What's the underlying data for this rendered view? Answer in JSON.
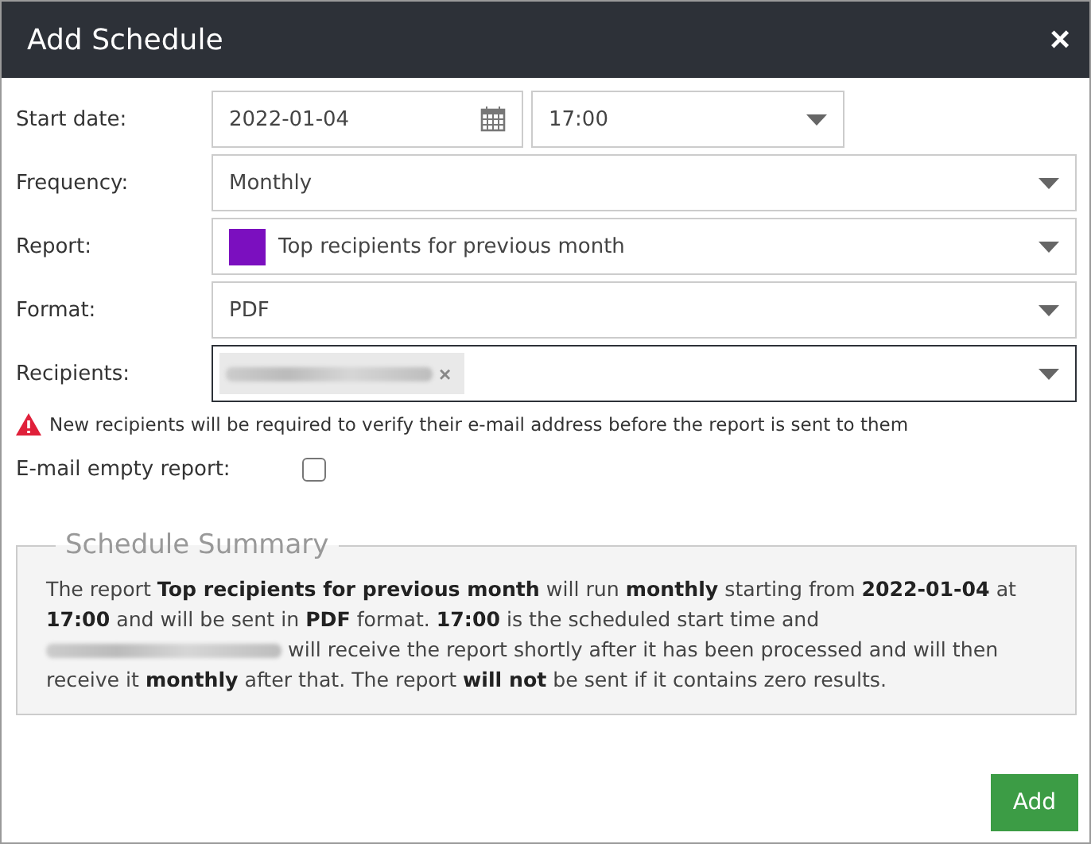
{
  "window": {
    "title": "Add Schedule",
    "close": "×"
  },
  "fields": [
    {
      "kind": "datetime",
      "label": "Start date:",
      "value": "2022-01-04",
      "time": "17:00"
    },
    {
      "kind": "select",
      "label": "Frequency:",
      "value": "Monthly"
    },
    {
      "kind": "report",
      "label": "Report:",
      "value": "Top recipients for previous month",
      "color": "#7b0fbf"
    },
    {
      "kind": "select",
      "label": "Format:",
      "value": "PDF"
    },
    {
      "kind": "recipients",
      "label": "Recipients:",
      "remove": "×",
      "focused": true
    }
  ],
  "warning": "New recipients will be required to verify their e-mail address before the report is sent to them",
  "empty_report": {
    "label": "E-mail empty report:",
    "checked": false
  },
  "summary": {
    "legend": "Schedule Summary",
    "before": "The report **Top recipients for previous month** will run **monthly** starting from **2022-01-04** at **17:00** and will be sent in **PDF** format. **17:00** is the scheduled start time and",
    "after": "will receive the report shortly after it has been processed and will then receive it **monthly** after that. The report **will not** be sent if it contains zero results."
  },
  "buttons": [
    "Add"
  ]
}
